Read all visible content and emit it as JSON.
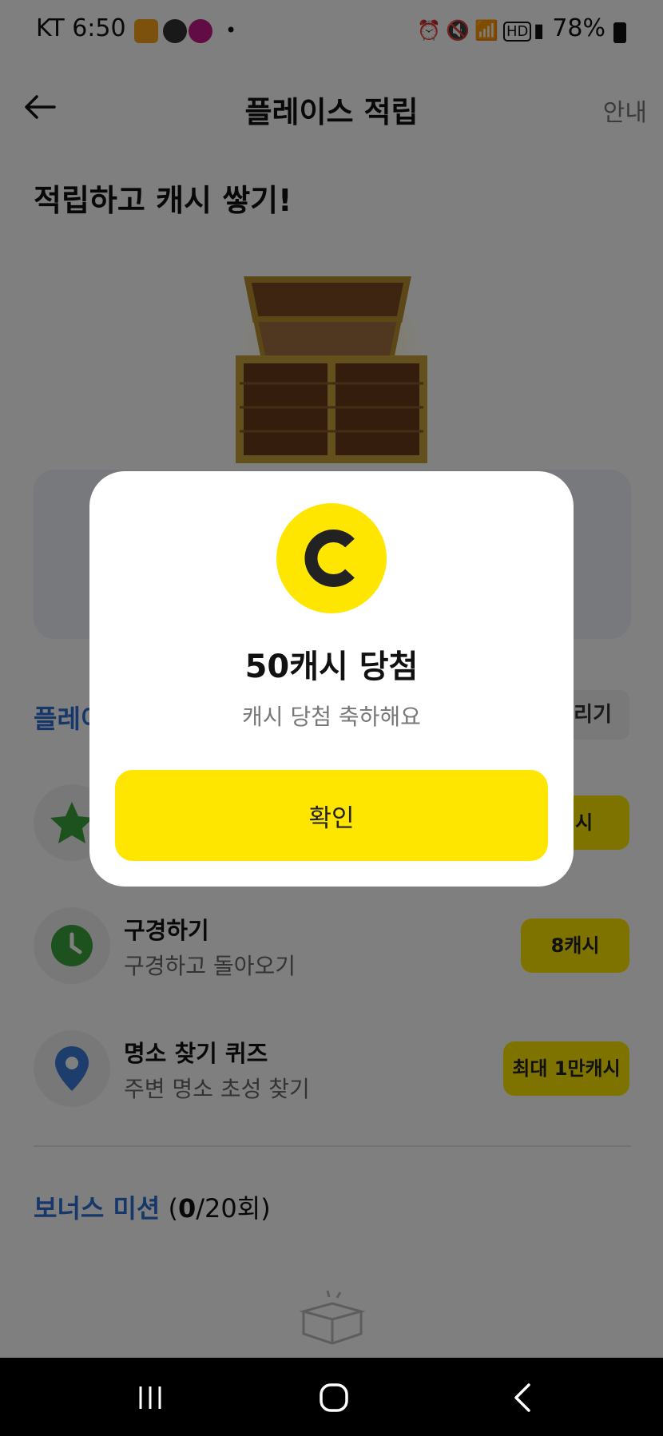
{
  "status_bar": {
    "time": "KT 6:50",
    "battery": "78%"
  },
  "header": {
    "title": "플레이스 적립",
    "guide_label": "안내"
  },
  "headline": "적립하고 캐시 쌓기!",
  "section": {
    "label": "플레이",
    "pill": "늘리기"
  },
  "tasks": [
    {
      "title": "",
      "subtitle": "",
      "reward": "캐시"
    },
    {
      "title": "구경하기",
      "subtitle": "구경하고 돌아오기",
      "reward": "8캐시"
    },
    {
      "title": "명소 찾기 퀴즈",
      "subtitle": "주변 명소 초성 찾기",
      "reward": "최대 1만캐시"
    }
  ],
  "bonus": {
    "label": "보너스 미션",
    "count_open": " (",
    "count_done": "0",
    "count_rest": "/20회)"
  },
  "dialog": {
    "coin_letter": "C",
    "title": "50캐시 당첨",
    "subtitle": "캐시 당첨 축하해요",
    "confirm_label": "확인"
  },
  "colors": {
    "accent_yellow": "#ffe600",
    "accent_blue": "#2f6fd6",
    "star_green": "#3aa33a",
    "pin_blue": "#3b7dd8"
  }
}
